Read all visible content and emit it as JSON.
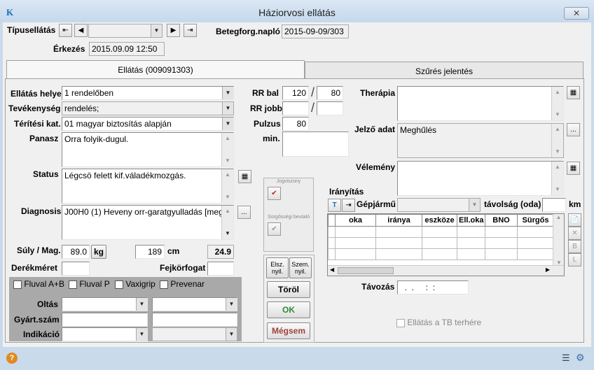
{
  "window": {
    "title": "Háziorvosi ellátás",
    "close_glyph": "✕"
  },
  "header": {
    "tipusellatas_label": "Típusellátás",
    "tipusellatas_value": "",
    "erkezes_label": "Érkezés",
    "erkezes_value": "2015.09.09 12:50",
    "betegforg_label": "Betegforg.napló",
    "betegforg_value": "2015-09-09/303"
  },
  "tabs": [
    {
      "label": "Ellátás (009091303)"
    },
    {
      "label": "Szűrés jelentés"
    }
  ],
  "left": {
    "ellatas_helye_label": "Ellátás helye",
    "ellatas_helye_value": "1 rendelőben",
    "tevekenyseg_label": "Tevékenység",
    "tevekenyseg_value": "rendelés;",
    "teritesi_label": "Térítési kat.",
    "teritesi_value": "01 magyar biztosítás alapján",
    "panasz_label": "Panasz",
    "panasz_value": "Orra folyik-dugul.",
    "status_label": "Status",
    "status_value": "Légcsö felett kif.váladékmozgás.",
    "diagnozis_label": "Diagnosis",
    "diagnozis_value": "J00H0 (1) Heveny orr-garatgyulladás [meg",
    "suly_label": "Súly / Mag.",
    "suly_value": "89.0",
    "suly_unit": "kg",
    "mag_value": "189",
    "mag_unit": "cm",
    "bmi_value": "24.9",
    "derek_label": "Derékméret",
    "fejkor_label": "Fejkörfogat"
  },
  "vaccines": {
    "checks": [
      "Fluval A+B",
      "Fluval P",
      "Vaxigrip",
      "Prevenar"
    ],
    "oltas_label": "Oltás",
    "gyart_label": "Gyárt.szám",
    "indikacio_label": "Indikáció"
  },
  "vitals": {
    "rr_bal_label": "RR bal",
    "rr_bal_sys": "120",
    "rr_bal_dia": "80",
    "rr_jobb_label": "RR jobb",
    "pulzus_label": "Pulzus",
    "pulzus_value": "80",
    "min_label": "min."
  },
  "middle": {
    "jogviszony_label": "Jogviszony",
    "surgossegi_label": "Sürgősségi beutaló",
    "elsz_label": "Elsz. nyil.",
    "szem_label": "Szem. nyil.",
    "torol_label": "Töröl",
    "ok_label": "OK",
    "megsem_label": "Mégsem"
  },
  "right": {
    "terapia_label": "Therápia",
    "jelzo_label": "Jelző adat",
    "jelzo_value": "Meghűlés",
    "velemeny_label": "Vélemény",
    "iranyitas_label": "Irányítás",
    "gepjarmu_label": "Gépjármű",
    "tavolsag_label": "távolság (oda)",
    "km_label": "km",
    "grid_headers": [
      "oka",
      "iránya",
      "eszköze",
      "Ell.oka",
      "BNO",
      "Sürgős"
    ],
    "side_buttons": [
      "📄",
      "✕",
      "B",
      "L"
    ],
    "tavozas_label": "Távozás",
    "tavozas_value": "  .  .     :  :",
    "tb_label": "Ellátás a TB terhére"
  },
  "statusbar": {
    "help_glyph": "?"
  },
  "colors": {
    "accent": "#1a6fb0",
    "ok": "#2e8b2e",
    "cancel": "#a04040"
  }
}
